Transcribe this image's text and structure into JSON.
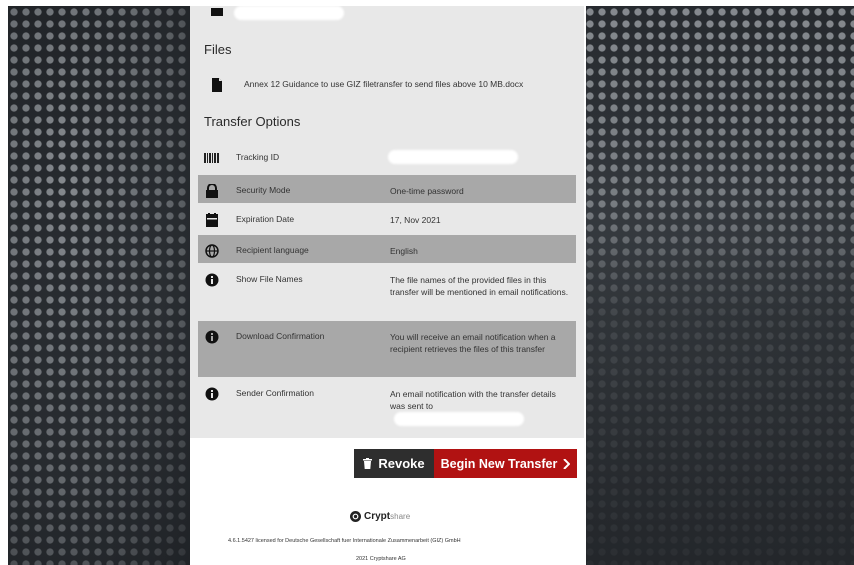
{
  "files": {
    "title": "Files",
    "items": [
      {
        "icon": "file-icon",
        "name": "Annex 12 Guidance to use GIZ filetransfer to send files above 10 MB.docx"
      }
    ]
  },
  "transfer_options": {
    "title": "Transfer Options",
    "rows": [
      {
        "icon": "barcode-icon",
        "label": "Tracking ID",
        "value": ""
      },
      {
        "icon": "lock-icon",
        "label": "Security Mode",
        "value": "One-time password"
      },
      {
        "icon": "calendar-icon",
        "label": "Expiration Date",
        "value": "17, Nov 2021"
      },
      {
        "icon": "globe-icon",
        "label": "Recipient language",
        "value": "English"
      },
      {
        "icon": "info-icon",
        "label": "Show File Names",
        "value": "The file names of the provided files in this transfer will be mentioned in email notifications."
      },
      {
        "icon": "info-icon",
        "label": "Download Confirmation",
        "value": "You will receive an email notification when a recipient retrieves the files of this transfer"
      },
      {
        "icon": "info-icon",
        "label": "Sender Confirmation",
        "value": "An email notification with the transfer details was sent to"
      }
    ]
  },
  "actions": {
    "revoke_label": "Revoke",
    "new_transfer_label": "Begin New Transfer"
  },
  "footer": {
    "brand": "Crypt",
    "brand_suffix": "share",
    "license_line": "4.6.1.5427 licensed for Deutsche Gesellschaft fuer Internationale Zusammenarbeit (GIZ) GmbH",
    "copyright_line": "2021 Cryptshare AG"
  },
  "colors": {
    "accent_red": "#b11212",
    "dark_button": "#2e2e2e",
    "card_bg": "#e8e8e8",
    "row_shade": "#a8a8a8"
  }
}
